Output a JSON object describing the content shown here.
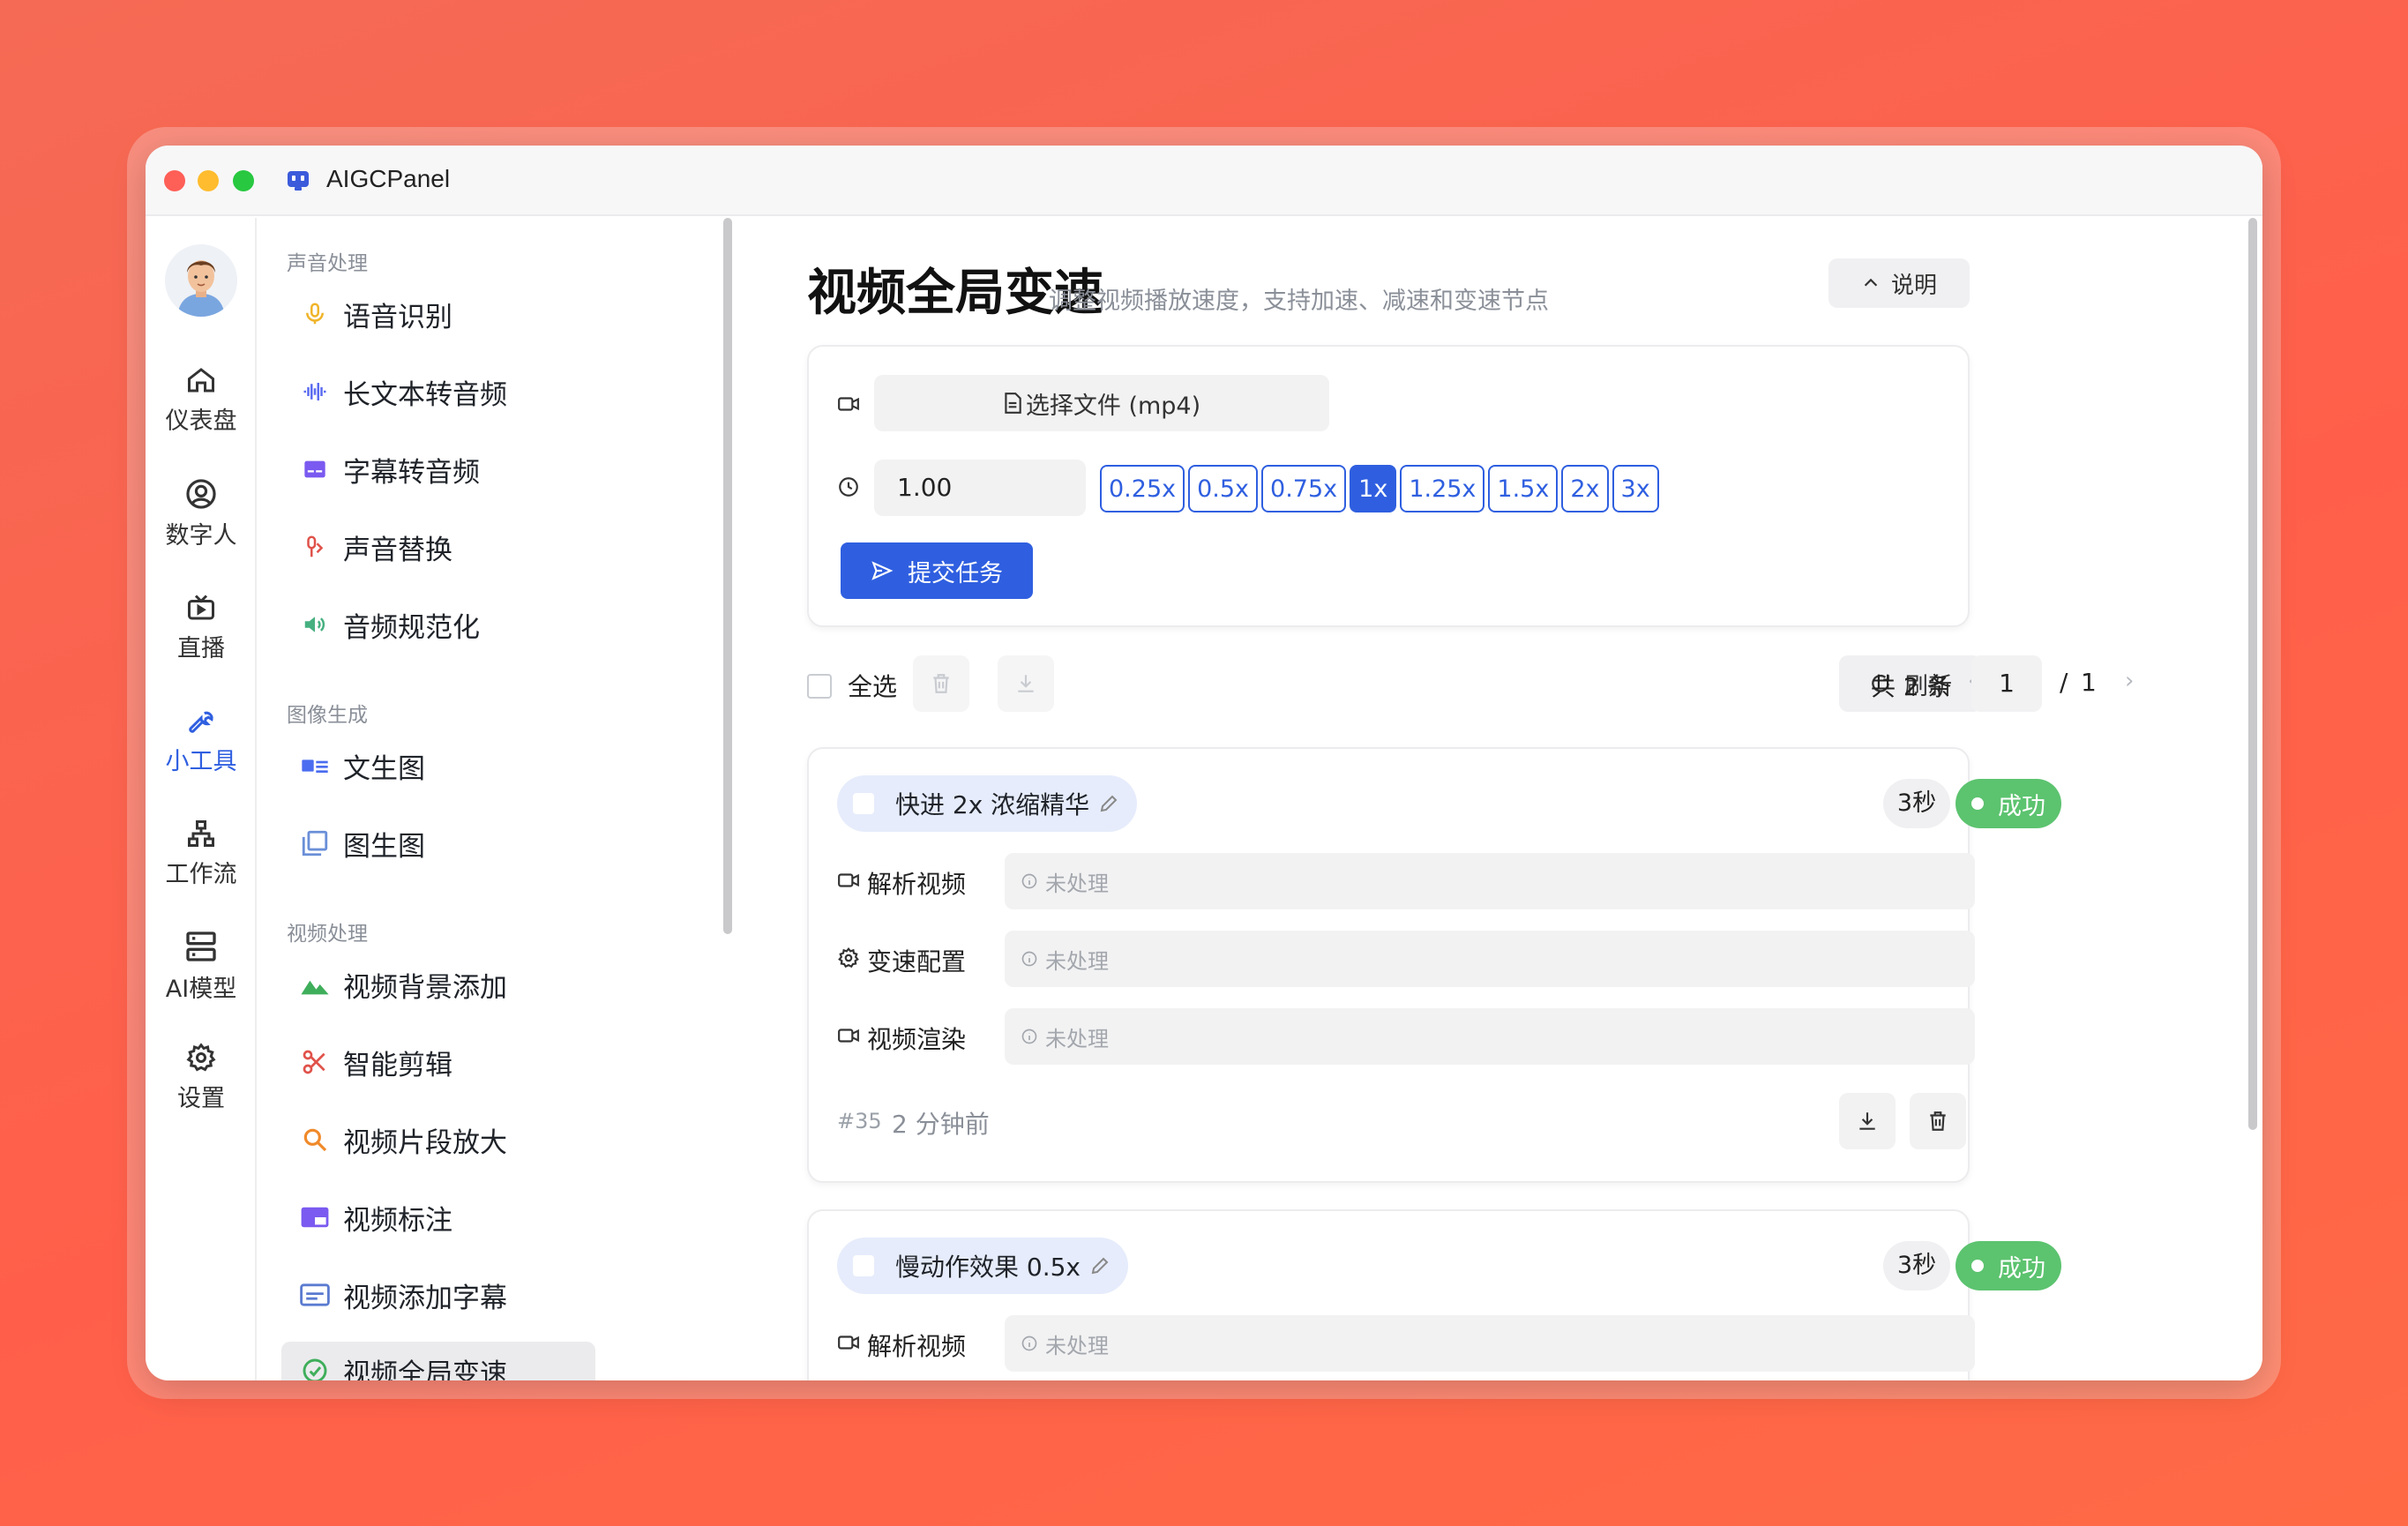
{
  "app": {
    "title": "AIGCPanel"
  },
  "rail": {
    "items": [
      {
        "label": "仪表盘",
        "icon": "home-icon"
      },
      {
        "label": "数字人",
        "icon": "user-circle-icon"
      },
      {
        "label": "直播",
        "icon": "tv-icon"
      },
      {
        "label": "小工具",
        "icon": "wrench-icon",
        "active": true
      },
      {
        "label": "工作流",
        "icon": "workflow-icon"
      },
      {
        "label": "AI模型",
        "icon": "server-icon"
      },
      {
        "label": "设置",
        "icon": "gear-icon"
      }
    ]
  },
  "menu": {
    "sections": [
      "声音处理",
      "图像生成",
      "视频处理"
    ],
    "items": [
      {
        "label": "语音识别",
        "icon": "microphone-icon"
      },
      {
        "label": "长文本转音频",
        "icon": "waveform-icon"
      },
      {
        "label": "字幕转音频",
        "icon": "subtitle-icon"
      },
      {
        "label": "声音替换",
        "icon": "mic-swap-icon"
      },
      {
        "label": "音频规范化",
        "icon": "speaker-icon"
      },
      {
        "label": "文生图",
        "icon": "text-image-icon"
      },
      {
        "label": "图生图",
        "icon": "image-layers-icon"
      },
      {
        "label": "视频背景添加",
        "icon": "landscape-icon"
      },
      {
        "label": "智能剪辑",
        "icon": "scissors-icon"
      },
      {
        "label": "视频片段放大",
        "icon": "magnifier-icon"
      },
      {
        "label": "视频标注",
        "icon": "annotate-icon"
      },
      {
        "label": "视频添加字幕",
        "icon": "caption-icon"
      },
      {
        "label": "视频全局变速",
        "icon": "speedometer-icon",
        "active": true
      }
    ]
  },
  "page": {
    "title": "视频全局变速",
    "subtitle": "调整视频播放速度，支持加速、减速和变速节点",
    "help_label": "说明"
  },
  "form": {
    "file_button": "选择文件 (mp4)",
    "speed_value": "1.00",
    "speed_options": [
      "0.25x",
      "0.5x",
      "0.75x",
      "1x",
      "1.25x",
      "1.5x",
      "2x",
      "3x"
    ],
    "selected_speed": "1x",
    "submit_label": "提交任务"
  },
  "toolbar": {
    "select_all": "全选",
    "refresh": "刷新",
    "total": "共 2 条",
    "page_current": "1",
    "page_sep": "/",
    "page_total": "1"
  },
  "tasks": [
    {
      "title": "快进 2x 浓缩精华",
      "duration": "3秒",
      "status": "成功",
      "steps": [
        {
          "label": "解析视频",
          "state": "未处理"
        },
        {
          "label": "变速配置",
          "state": "未处理"
        },
        {
          "label": "视频渲染",
          "state": "未处理"
        }
      ],
      "id": "#35",
      "time": "2 分钟前"
    },
    {
      "title": "慢动作效果 0.5x",
      "duration": "3秒",
      "status": "成功",
      "steps": [
        {
          "label": "解析视频",
          "state": "未处理"
        }
      ]
    }
  ],
  "colors": {
    "accent": "#2f5fe0",
    "success": "#5cc36f",
    "background": "#ff5f4a"
  }
}
